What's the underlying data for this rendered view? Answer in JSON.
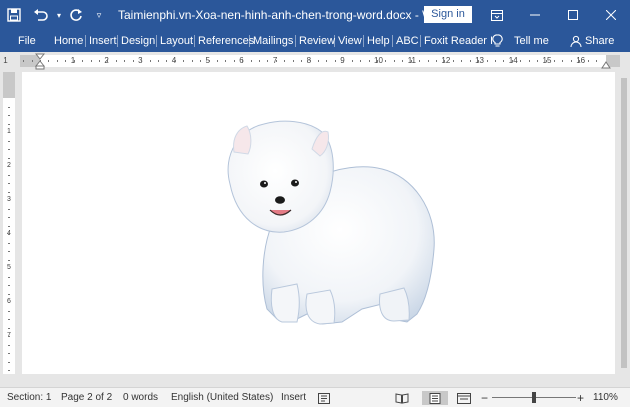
{
  "titlebar": {
    "document_title": "Taimienphi.vn-Xoa-nen-hinh-anh-chen-trong-word.docx - Word",
    "signin_label": "Sign in",
    "quick_access": [
      "save-icon",
      "undo-icon",
      "redo-icon",
      "customize-icon"
    ],
    "window_controls": [
      "ribbon-display-icon",
      "minimize-icon",
      "maximize-icon",
      "close-icon"
    ]
  },
  "ribbon": {
    "tabs": [
      "File",
      "Home",
      "Insert",
      "Design",
      "Layout",
      "References",
      "Mailings",
      "Review",
      "View",
      "Help",
      "ABC",
      "Foxit Reader I"
    ],
    "tell_me": "Tell me",
    "share": "Share"
  },
  "ruler": {
    "tab_selector": "L",
    "h_numbers": [
      "1",
      "1",
      "2",
      "3",
      "4",
      "5",
      "6",
      "7",
      "8",
      "9",
      "10",
      "11",
      "12",
      "13",
      "14",
      "15",
      "16"
    ],
    "v_numbers": [
      "1",
      "2",
      "3",
      "4",
      "5",
      "6",
      "7",
      "8"
    ]
  },
  "document": {
    "image": "white-pomeranian-puppy"
  },
  "statusbar": {
    "section": "Section: 1",
    "page": "Page 2 of 2",
    "words": "0 words",
    "language": "English (United States)",
    "mode": "Insert",
    "zoom": "110%",
    "zoom_minus": "−",
    "zoom_plus": "+"
  },
  "colors": {
    "accent": "#2b579a",
    "canvas": "#e6e6e6",
    "page": "#ffffff"
  }
}
